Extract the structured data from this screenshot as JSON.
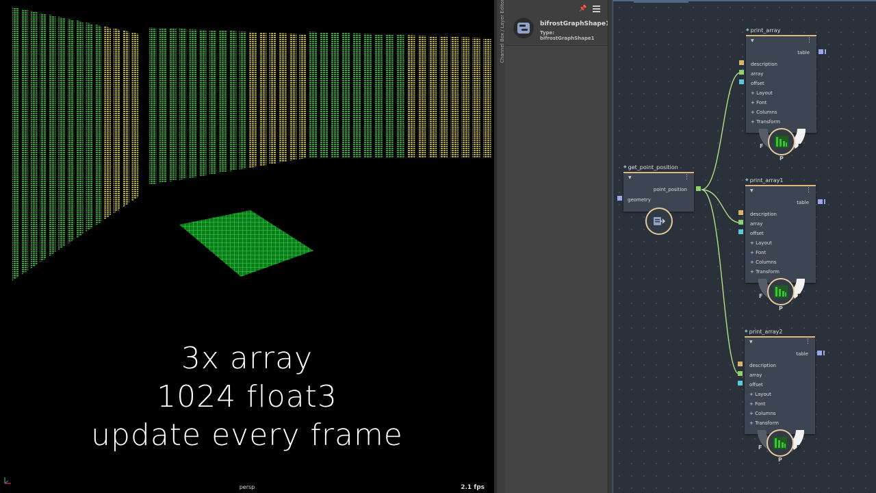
{
  "viewport": {
    "overlay_lines": [
      "3x array",
      "1024 float3",
      "update every frame"
    ],
    "camera_name": "persp",
    "fps": "2.1 fps"
  },
  "side_tab": {
    "label": "Channel Box / Layer Editor"
  },
  "attribute_editor": {
    "node_name": "bifrostGraphShape1",
    "node_type": "Type: bifrostGraphShape1",
    "icons": [
      "pin-icon",
      "menu-icon",
      "graph-node-icon"
    ]
  },
  "graph": {
    "get_point_position": {
      "name": "get_point_position",
      "output": "point_position",
      "input": "geometry"
    },
    "print_nodes": [
      {
        "name": "print_array",
        "output": "table",
        "inputs": [
          "description",
          "array",
          "offset"
        ],
        "groups": [
          "Layout",
          "Font",
          "Columns",
          "Transform"
        ],
        "ring": [
          "F",
          "P",
          "D"
        ]
      },
      {
        "name": "print_array1",
        "output": "table",
        "inputs": [
          "description",
          "array",
          "offset"
        ],
        "groups": [
          "Layout",
          "Font",
          "Columns",
          "Transform"
        ],
        "ring": [
          "F",
          "P",
          "D"
        ]
      },
      {
        "name": "print_array2",
        "output": "table",
        "inputs": [
          "description",
          "array",
          "offset"
        ],
        "groups": [
          "Layout",
          "Font",
          "Columns",
          "Transform"
        ],
        "ring": [
          "F",
          "P",
          "D"
        ]
      }
    ],
    "colors": {
      "description_port": "#d9b46a",
      "array_port": "#8fd26b",
      "offset_port": "#5cc9d8",
      "table_port": "#9aa7ea",
      "geometry_port": "#9aa7ea",
      "wire": "#b4e08a",
      "node_header": "#e0b880",
      "graph_bg": "#2b313a",
      "text_green": "#39c43a",
      "text_yellow": "#d8cf3d"
    }
  }
}
